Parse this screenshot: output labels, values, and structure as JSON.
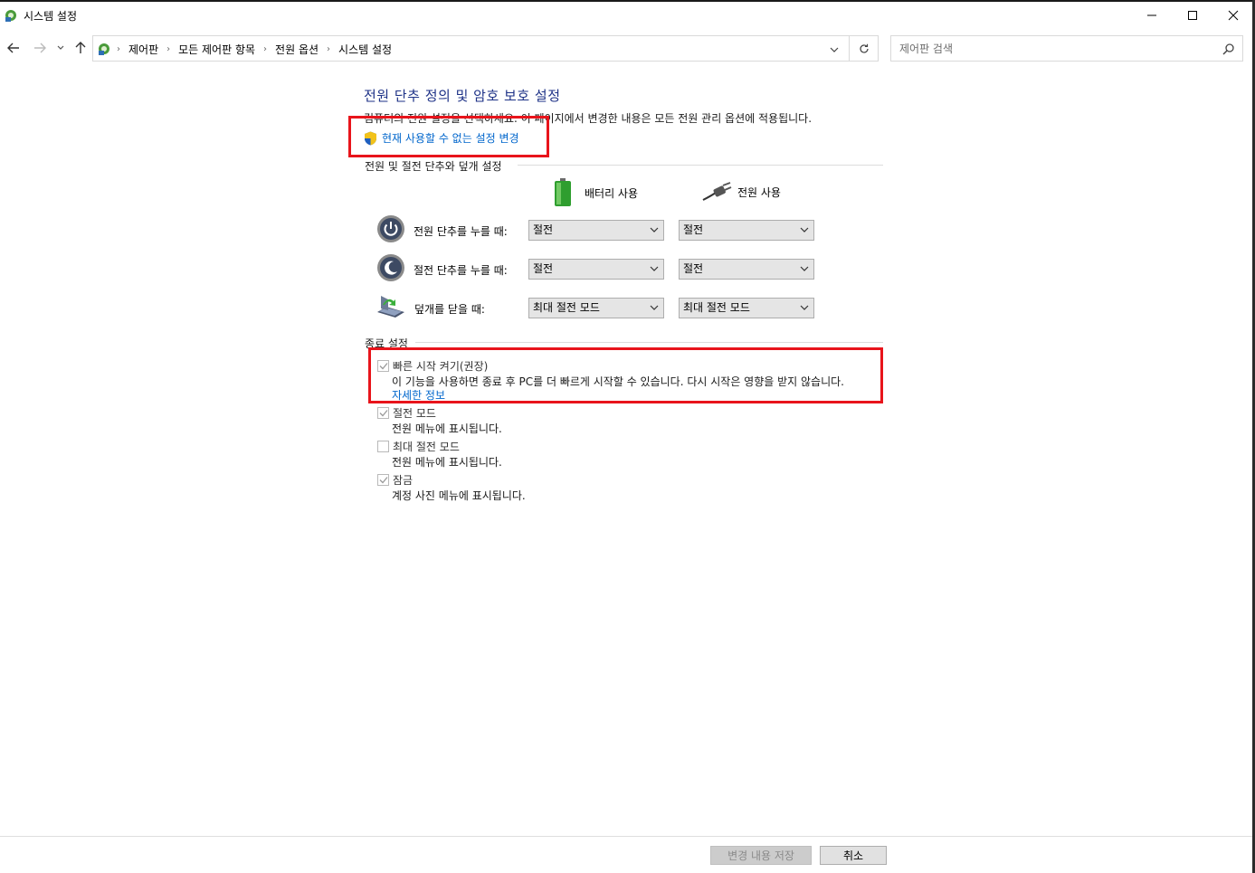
{
  "window": {
    "title": "시스템 설정",
    "minimize_icon": "minimize-icon",
    "maximize_icon": "maximize-icon",
    "close_icon": "close-icon"
  },
  "nav": {
    "breadcrumbs": [
      "제어판",
      "모든 제어판 항목",
      "전원 옵션",
      "시스템 설정"
    ],
    "search_placeholder": "제어판 검색"
  },
  "main": {
    "heading": "전원 단추 정의 및 암호 보호 설정",
    "description": "컴퓨터의 전원 설정을 선택하세요. 이 페이지에서 변경한 내용은 모든 전원 관리 옵션에 적용됩니다.",
    "change_link": "현재 사용할 수 없는 설정 변경",
    "power_group_title": "전원 및 절전 단추와 덮개 설정",
    "col_battery": "배터리 사용",
    "col_plugged": "전원 사용",
    "rows": [
      {
        "label": "전원 단추를 누를 때:",
        "battery": "절전",
        "plugged": "절전"
      },
      {
        "label": "절전 단추를 누를 때:",
        "battery": "절전",
        "plugged": "절전"
      },
      {
        "label": "덮개를 닫을 때:",
        "battery": "최대 절전 모드",
        "plugged": "최대 절전 모드"
      }
    ],
    "shutdown_group_title": "종료 설정",
    "shutdown_options": [
      {
        "label": "빠른 시작 켜기(권장)",
        "checked": true,
        "desc": "이 기능을 사용하면 종료 후 PC를 더 빠르게 시작할 수 있습니다. 다시 시작은 영향을 받지 않습니다.",
        "link": "자세한 정보"
      },
      {
        "label": "절전 모드",
        "checked": true,
        "desc": "전원 메뉴에 표시됩니다."
      },
      {
        "label": "최대 절전 모드",
        "checked": false,
        "desc": "전원 메뉴에 표시됩니다."
      },
      {
        "label": "잠금",
        "checked": true,
        "desc": "계정 사진 메뉴에 표시됩니다."
      }
    ]
  },
  "footer": {
    "save_label": "변경 내용 저장",
    "cancel_label": "취소"
  },
  "colors": {
    "heading": "#1e3287",
    "link": "#0066cc",
    "highlight": "#e8141b"
  }
}
